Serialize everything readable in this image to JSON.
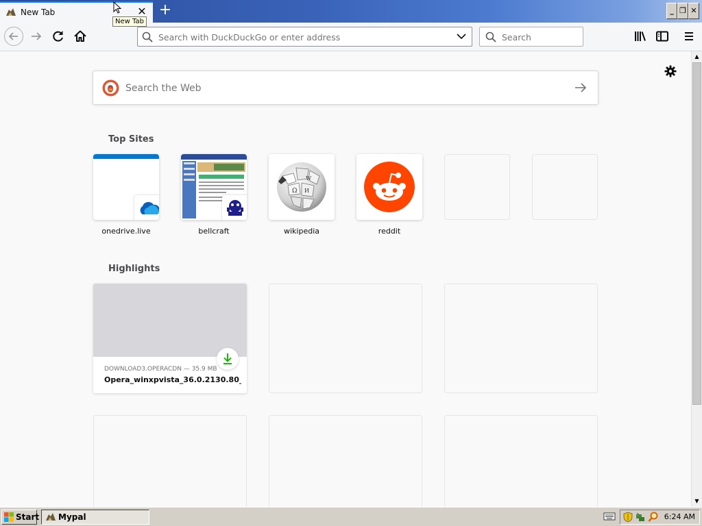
{
  "browser": {
    "tab": {
      "title": "New Tab",
      "close_glyph": "✕"
    },
    "new_tab_glyph": "+",
    "tooltip": "New Tab",
    "window_buttons": [
      "_",
      "❐",
      "✕"
    ],
    "urlbar": {
      "placeholder": "Search with DuckDuckGo or enter address"
    },
    "searchbar": {
      "placeholder": "Search"
    }
  },
  "newtab": {
    "websearch": {
      "placeholder": "Search the Web"
    },
    "top_sites_title": "Top Sites",
    "top_sites": [
      {
        "label": "onedrive.live",
        "icon": "onedrive-icon"
      },
      {
        "label": "bellcraft",
        "icon": "bellcraft-thumbnail"
      },
      {
        "label": "wikipedia",
        "icon": "wikipedia-icon"
      },
      {
        "label": "reddit",
        "icon": "reddit-icon"
      },
      {
        "label": "",
        "icon": ""
      },
      {
        "label": "",
        "icon": ""
      }
    ],
    "highlights_title": "Highlights",
    "highlight": {
      "meta": "DOWNLOAD3.OPERACDN — 35.9 MB",
      "filename": "Opera_winxpvista_36.0.2130.80_..."
    }
  },
  "taskbar": {
    "start_label": "Start",
    "task_label": "Mypal",
    "clock": "6:24 AM"
  },
  "colors": {
    "accent": "#0a84ff",
    "reddit": "#ff4500",
    "download_green": "#12bc00"
  }
}
